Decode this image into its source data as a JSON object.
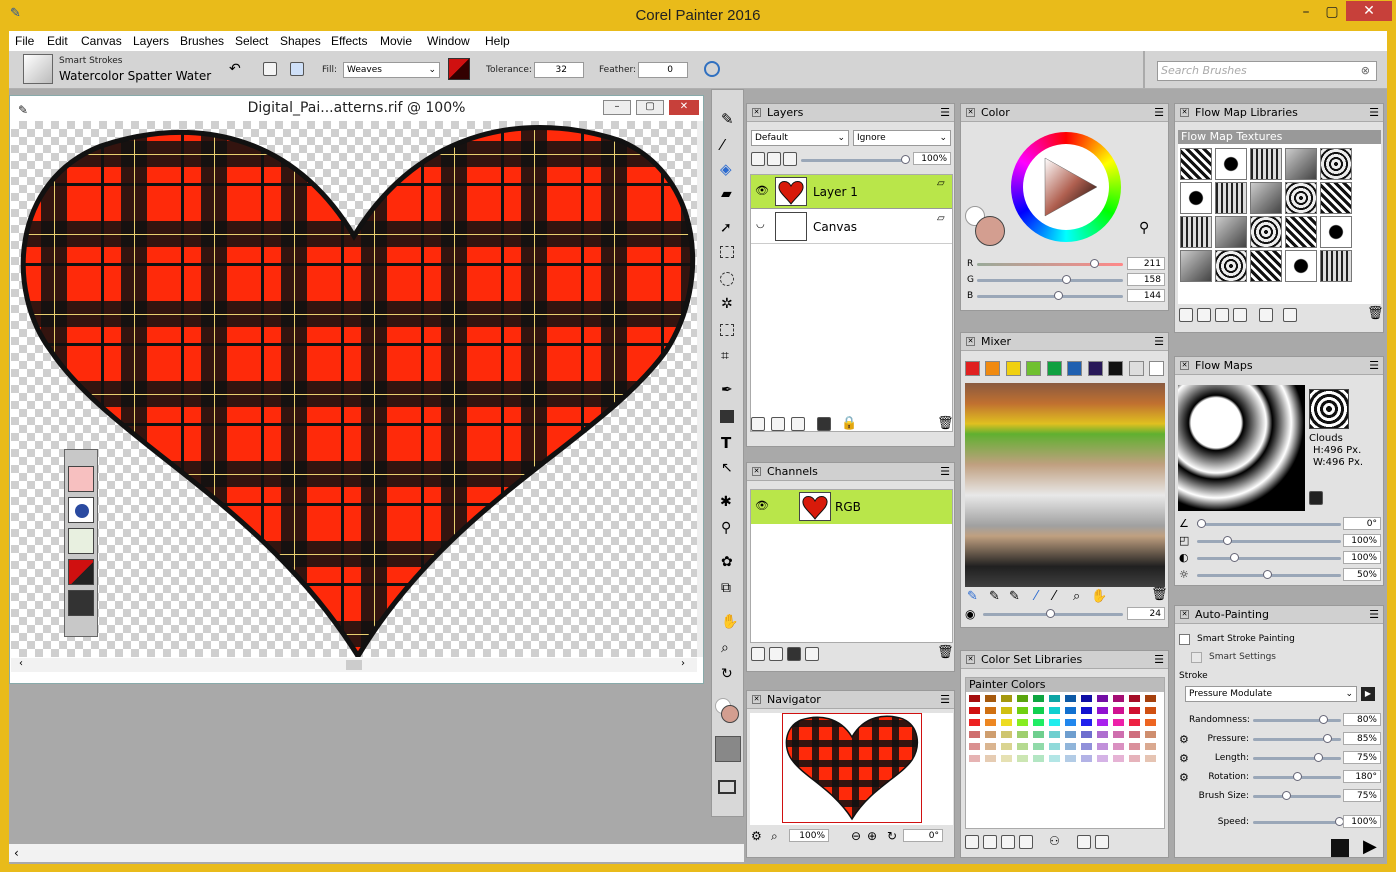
{
  "app": {
    "title": "Corel Painter 2016"
  },
  "menu": [
    "File",
    "Edit",
    "Canvas",
    "Layers",
    "Brushes",
    "Select",
    "Shapes",
    "Effects",
    "Movie",
    "Window",
    "Help"
  ],
  "toolbar": {
    "brush_category": "Smart Strokes",
    "brush_variant": "Watercolor Spatter Water",
    "fill_label": "Fill:",
    "fill_value": "Weaves",
    "tolerance_label": "Tolerance:",
    "tolerance_value": "32",
    "feather_label": "Feather:",
    "feather_value": "0",
    "search_placeholder": "Search Brushes"
  },
  "document": {
    "title": "Digital_Pai...atterns.rif @ 100%",
    "zoom": "100%"
  },
  "layers": {
    "title": "Layers",
    "composite_method": "Default",
    "depth": "Ignore",
    "opacity": "100%",
    "items": [
      {
        "name": "Layer 1"
      },
      {
        "name": "Canvas"
      }
    ]
  },
  "channels": {
    "title": "Channels",
    "items": [
      {
        "name": "RGB"
      }
    ]
  },
  "navigator": {
    "title": "Navigator",
    "zoom": "100%",
    "rotation": "0°"
  },
  "color": {
    "title": "Color",
    "r_label": "R",
    "g_label": "G",
    "b_label": "B",
    "r": "211",
    "g": "158",
    "b": "144",
    "main_color": "#d39e90"
  },
  "mixer": {
    "title": "Mixer",
    "size": "24",
    "swatches": [
      "#e02020",
      "#f08a10",
      "#f0d010",
      "#70c030",
      "#10a040",
      "#2060b0",
      "#281858",
      "#111111",
      "#dddddd",
      "#ffffff"
    ]
  },
  "color_set": {
    "title": "Color Set Libraries",
    "name": "Painter Colors"
  },
  "flow_map_libraries": {
    "title": "Flow Map Libraries",
    "section": "Flow Map Textures"
  },
  "flow_maps": {
    "title": "Flow Maps",
    "name": "Clouds",
    "height": "H:496 Px.",
    "width": "W:496 Px.",
    "values": [
      "0°",
      "100%",
      "100%",
      "50%"
    ]
  },
  "auto_painting": {
    "title": "Auto-Painting",
    "smart_stroke_painting": "Smart Stroke Painting",
    "smart_settings": "Smart Settings",
    "stroke_label": "Stroke",
    "stroke_value": "Pressure Modulate",
    "params": [
      {
        "label": "Randomness:",
        "value": "80%"
      },
      {
        "label": "Pressure:",
        "value": "85%"
      },
      {
        "label": "Length:",
        "value": "75%"
      },
      {
        "label": "Rotation:",
        "value": "180°"
      },
      {
        "label": "Brush Size:",
        "value": "75%"
      }
    ],
    "speed_label": "Speed:",
    "speed_value": "100%"
  }
}
